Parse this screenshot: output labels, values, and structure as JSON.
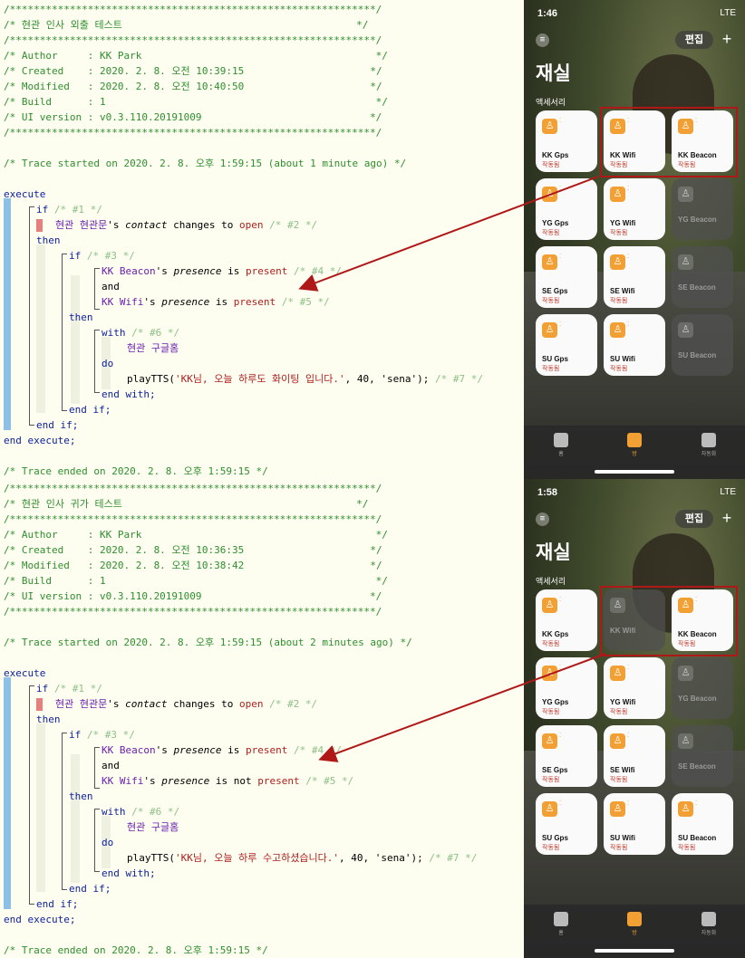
{
  "logs": [
    {
      "header": {
        "stars": "/*************************************************************/",
        "title": "/* 현관 인사 외출 테스트                                       */",
        "author": "/* Author     : KK Park                                       */",
        "created": "/* Created    : 2020. 2. 8. 오전 10:39:15                     */",
        "modified": "/* Modified   : 2020. 2. 8. 오전 10:40:50                     */",
        "build": "/* Build      : 1                                             */",
        "ui_version": "/* UI version : v0.3.110.20191009                            */"
      },
      "trace_start": "/* Trace started on 2020. 2. 8. 오후 1:59:15 (about 1 minute ago) */",
      "trace_end": "/* Trace ended on 2020. 2. 8. 오후 1:59:15 */",
      "not_word": "",
      "tts_message": "'KK님, 오늘 하루도 화이팅 입니다.'",
      "tts_args": ", 40, 'sena');",
      "stmt7": "/* #7 */"
    },
    {
      "header": {
        "stars": "/*************************************************************/",
        "title": "/* 현관 인사 귀가 테스트                                       */",
        "author": "/* Author     : KK Park                                       */",
        "created": "/* Created    : 2020. 2. 8. 오전 10:36:35                     */",
        "modified": "/* Modified   : 2020. 2. 8. 오전 10:38:42                     */",
        "build": "/* Build      : 1                                             */",
        "ui_version": "/* UI version : v0.3.110.20191009                            */"
      },
      "trace_start": "/* Trace started on 2020. 2. 8. 오후 1:59:15 (about 2 minutes ago) */",
      "trace_end": "/* Trace ended on 2020. 2. 8. 오후 1:59:15 */",
      "not_word": "not ",
      "tts_message": "'KK님, 오늘 하루 수고하셨습니다.'",
      "tts_args": ", 40, 'sena');",
      "stmt7": "/* #7 */"
    }
  ],
  "code": {
    "execute": "execute",
    "if": "if",
    "then": "then",
    "and": "and",
    "with": "with",
    "do": "do",
    "end_with": "end with;",
    "end_if": "end if;",
    "end_execute": "end execute;",
    "c1": "/* #1 */",
    "c2": "/* #2 */",
    "c3": "/* #3 */",
    "c4": "/* #4 */",
    "c5": "/* #5 */",
    "c6": "/* #6 */",
    "door": "현관 현관문",
    "contact_pre": "'s ",
    "contact": "contact",
    "changes_to": " changes to ",
    "open": "open",
    "beacon": "KK Beacon",
    "wifi": "KK Wifi",
    "presence_pre": "'s ",
    "presence": "presence",
    "is": " is ",
    "present": "present",
    "speaker": "현관 구글홈",
    "playtts": "playTTS("
  },
  "phones": [
    {
      "time": "1:46",
      "signal": "LTE",
      "edit": "편집",
      "plus": "+",
      "room": "재실",
      "section": "액세서리",
      "tiles": [
        {
          "name": "KK Gps",
          "status": "작동됨",
          "on": true
        },
        {
          "name": "KK Wifi",
          "status": "작동됨",
          "on": true
        },
        {
          "name": "KK Beacon",
          "status": "작동됨",
          "on": true
        },
        {
          "name": "YG Gps",
          "status": "작동됨",
          "on": true
        },
        {
          "name": "YG Wifi",
          "status": "작동됨",
          "on": true
        },
        {
          "name": "YG Beacon",
          "status": "",
          "on": false
        },
        {
          "name": "SE Gps",
          "status": "작동됨",
          "on": true
        },
        {
          "name": "SE Wifi",
          "status": "작동됨",
          "on": true
        },
        {
          "name": "SE Beacon",
          "status": "",
          "on": false
        },
        {
          "name": "SU Gps",
          "status": "작동됨",
          "on": true
        },
        {
          "name": "SU Wifi",
          "status": "작동됨",
          "on": true
        },
        {
          "name": "SU Beacon",
          "status": "",
          "on": false
        }
      ],
      "tabs": [
        "홈",
        "방",
        "자동화"
      ]
    },
    {
      "time": "1:58",
      "signal": "LTE",
      "edit": "편집",
      "plus": "+",
      "room": "재실",
      "section": "액세서리",
      "tiles": [
        {
          "name": "KK Gps",
          "status": "작동됨",
          "on": true
        },
        {
          "name": "KK Wifi",
          "status": "",
          "on": false
        },
        {
          "name": "KK Beacon",
          "status": "작동됨",
          "on": true
        },
        {
          "name": "YG Gps",
          "status": "작동됨",
          "on": true
        },
        {
          "name": "YG Wifi",
          "status": "작동됨",
          "on": true
        },
        {
          "name": "YG Beacon",
          "status": "",
          "on": false
        },
        {
          "name": "SE Gps",
          "status": "작동됨",
          "on": true
        },
        {
          "name": "SE Wifi",
          "status": "작동됨",
          "on": true
        },
        {
          "name": "SE Beacon",
          "status": "",
          "on": false
        },
        {
          "name": "SU Gps",
          "status": "작동됨",
          "on": true
        },
        {
          "name": "SU Wifi",
          "status": "작동됨",
          "on": true
        },
        {
          "name": "SU Beacon",
          "status": "작동됨",
          "on": true
        }
      ],
      "tabs": [
        "홈",
        "방",
        "자동화"
      ]
    }
  ],
  "colors": {
    "accent": "#f2a033",
    "highlight_box": "#b01818",
    "comment": "#2f8f2f",
    "keyword": "#0b1f9e"
  }
}
